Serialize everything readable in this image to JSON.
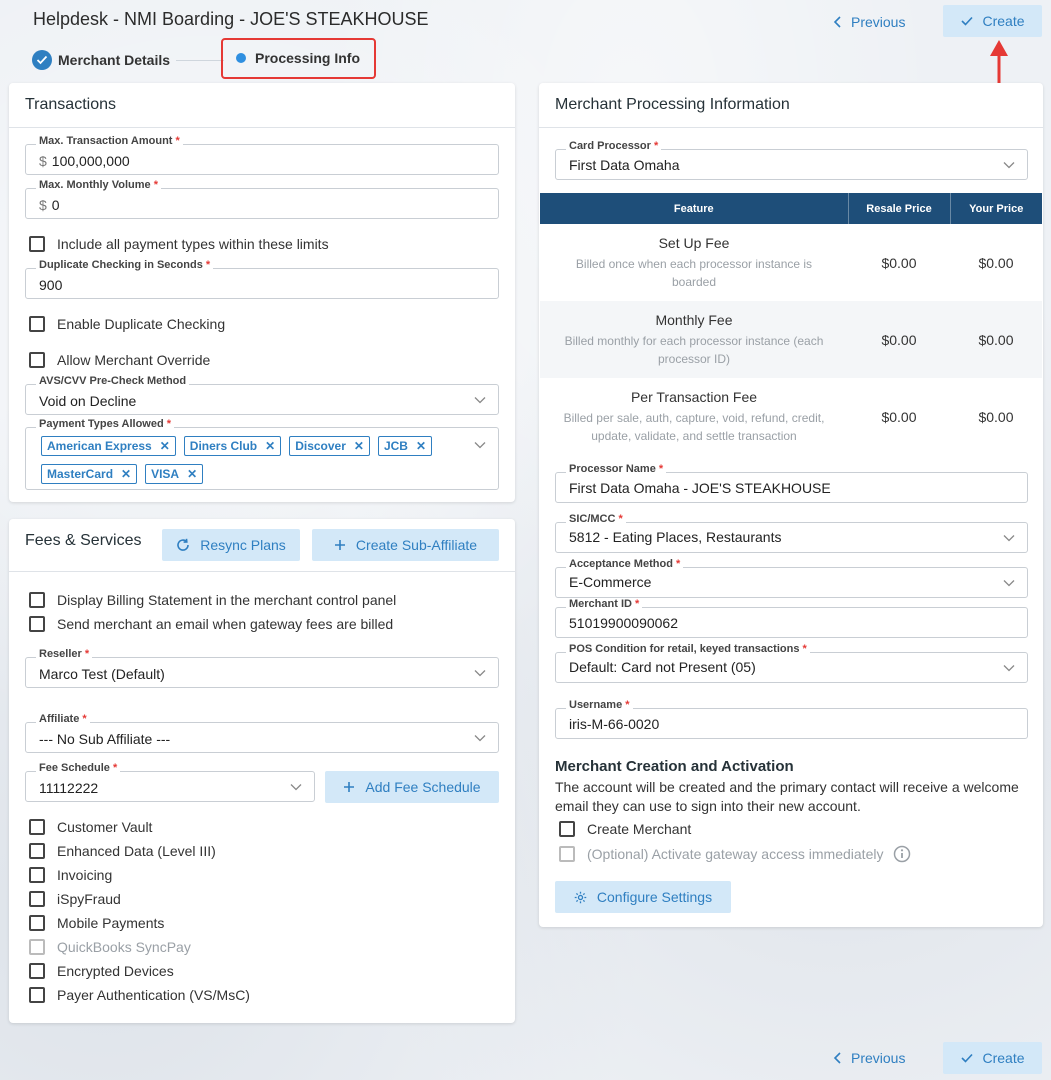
{
  "header": {
    "title": "Helpdesk - NMI Boarding - JOE'S STEAKHOUSE",
    "previous_label": "Previous",
    "create_label": "Create"
  },
  "stepper": {
    "step1": "Merchant Details",
    "step2": "Processing Info"
  },
  "transactions": {
    "title": "Transactions",
    "max_amount_label": "Max. Transaction Amount",
    "max_amount_value": "100,000,000",
    "max_monthly_label": "Max. Monthly Volume",
    "max_monthly_value": "0",
    "currency_symbol": "$",
    "include_all_label": "Include all payment types within these limits",
    "dup_seconds_label": "Duplicate Checking in Seconds",
    "dup_seconds_value": "900",
    "enable_dup_label": "Enable Duplicate Checking",
    "allow_override_label": "Allow Merchant Override",
    "avs_label": "AVS/CVV Pre-Check Method",
    "avs_value": "Void on Decline",
    "payment_types_label": "Payment Types Allowed",
    "payment_types": [
      "American Express",
      "Diners Club",
      "Discover",
      "JCB",
      "MasterCard",
      "VISA"
    ]
  },
  "fees": {
    "title": "Fees & Services",
    "resync_label": "Resync Plans",
    "create_sub_label": "Create Sub-Affiliate",
    "display_billing_label": "Display Billing Statement in the merchant control panel",
    "send_email_label": "Send merchant an email when gateway fees are billed",
    "reseller_label": "Reseller",
    "reseller_value": "Marco Test (Default)",
    "affiliate_label": "Affiliate",
    "affiliate_value": "--- No Sub Affiliate ---",
    "fee_schedule_label": "Fee Schedule",
    "fee_schedule_value": "11112222",
    "add_fee_label": "Add Fee Schedule",
    "services": [
      {
        "label": "Customer Vault",
        "disabled": false
      },
      {
        "label": "Enhanced Data (Level III)",
        "disabled": false
      },
      {
        "label": "Invoicing",
        "disabled": false
      },
      {
        "label": "iSpyFraud",
        "disabled": false
      },
      {
        "label": "Mobile Payments",
        "disabled": false
      },
      {
        "label": "QuickBooks SyncPay",
        "disabled": true
      },
      {
        "label": "Encrypted Devices",
        "disabled": false
      },
      {
        "label": "Payer Authentication (VS/MsC)",
        "disabled": false
      }
    ]
  },
  "processing": {
    "title": "Merchant Processing Information",
    "card_processor_label": "Card Processor",
    "card_processor_value": "First Data Omaha",
    "table_headers": [
      "Feature",
      "Resale Price",
      "Your Price"
    ],
    "table_rows": [
      {
        "name": "Set Up Fee",
        "desc": "Billed once when each processor instance is boarded",
        "resale": "$0.00",
        "yours": "$0.00"
      },
      {
        "name": "Monthly Fee",
        "desc": "Billed monthly for each processor instance (each processor ID)",
        "resale": "$0.00",
        "yours": "$0.00"
      },
      {
        "name": "Per Transaction Fee",
        "desc": "Billed per sale, auth, capture, void, refund, credit, update, validate, and settle transaction",
        "resale": "$0.00",
        "yours": "$0.00"
      }
    ],
    "processor_name_label": "Processor Name",
    "processor_name_value": "First Data Omaha - JOE'S STEAKHOUSE",
    "sic_label": "SIC/MCC",
    "sic_value": "5812 - Eating Places, Restaurants",
    "acceptance_label": "Acceptance Method",
    "acceptance_value": "E-Commerce",
    "merchant_id_label": "Merchant ID",
    "merchant_id_value": "51019900090062",
    "pos_label": "POS Condition for retail, keyed transactions",
    "pos_value": "Default: Card not Present (05)",
    "username_label": "Username",
    "username_value": "iris-M-66-0020",
    "creation_title": "Merchant Creation and Activation",
    "creation_text": "The account will be created and the primary contact will receive a welcome email they can use to sign into their new account.",
    "create_merchant_label": "Create Merchant",
    "activate_label": "(Optional) Activate gateway access immediately",
    "configure_label": "Configure Settings"
  },
  "colors": {
    "accent": "#2f7fc1",
    "accent_light": "#d3e8f8",
    "table_header": "#1e4e79",
    "highlight": "#e53935"
  },
  "icons": [
    "check-icon",
    "chevron-left-icon",
    "chevron-down-icon",
    "close-icon",
    "refresh-icon",
    "plus-icon",
    "gear-icon",
    "info-icon",
    "arrow-up-icon"
  ]
}
